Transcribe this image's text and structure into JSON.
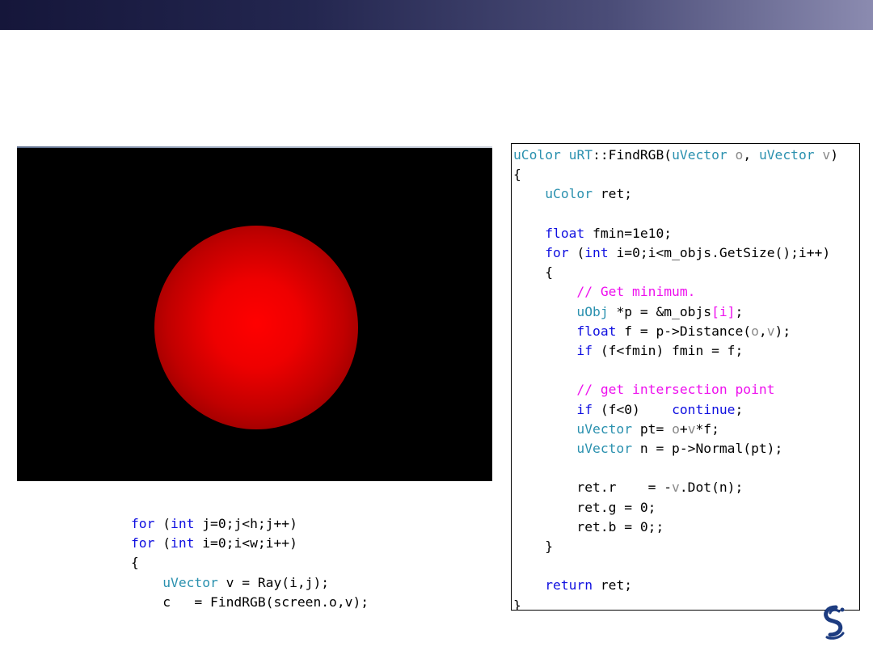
{
  "function_code": {
    "l1a": "uColor",
    "l1b": " ",
    "l1c": "uRT",
    "l1d": "::FindRGB(",
    "l1e": "uVector",
    "l1f": " ",
    "l1g": "o",
    "l1h": ", ",
    "l1i": "uVector",
    "l1j": " ",
    "l1k": "v",
    "l1l": ")",
    "l2": "{",
    "l3a": "    ",
    "l3b": "uColor",
    "l3c": " ret;",
    "l4": "",
    "l5a": "    ",
    "l5b": "float",
    "l5c": " fmin=1e10;",
    "l6a": "    ",
    "l6b": "for",
    "l6c": " (",
    "l6d": "int",
    "l6e": " i=0;i<m_objs.GetSize();i++)",
    "l7": "    {",
    "l8a": "        ",
    "l8b": "// Get minimum.",
    "l9a": "        ",
    "l9b": "uObj",
    "l9c": " *p = &m_objs",
    "l9d": "[i]",
    "l9e": ";",
    "l10a": "        ",
    "l10b": "float",
    "l10c": " f = p->Distance(",
    "l10d": "o",
    "l10e": ",",
    "l10f": "v",
    "l10g": ");",
    "l11a": "        ",
    "l11b": "if",
    "l11c": " (f<fmin) fmin = f;",
    "l12": "",
    "l13a": "        ",
    "l13b": "// get intersection point",
    "l14a": "        ",
    "l14b": "if",
    "l14c": " (f<0)    ",
    "l14d": "continue",
    "l14e": ";",
    "l15a": "        ",
    "l15b": "uVector",
    "l15c": " pt= ",
    "l15d": "o",
    "l15e": "+",
    "l15f": "v",
    "l15g": "*f;",
    "l16a": "        ",
    "l16b": "uVector",
    "l16c": " n = p->Normal(pt);",
    "l17": "",
    "l18a": "        ret.r    = -",
    "l18b": "v",
    "l18c": ".Dot(n);",
    "l19": "        ret.g = 0;",
    "l20": "        ret.b = 0;;",
    "l21": "    }",
    "l22": "",
    "l23a": "    ",
    "l23b": "return",
    "l23c": " ret;",
    "l24": "}"
  },
  "loop_code": {
    "l1a": "for",
    "l1b": " (",
    "l1c": "int",
    "l1d": " j=0;j<h;j++)",
    "l2a": "for",
    "l2b": " (",
    "l2c": "int",
    "l2d": " i=0;i<w;i++)",
    "l3": "{",
    "l4a": "    ",
    "l4b": "uVector",
    "l4c": " v = Ray(i,j);",
    "l5": "    c   = FindRGB(screen.o,v);"
  },
  "colors": {
    "keyword": "#1010e0",
    "type": "#2b91af",
    "comment": "#ee10ee",
    "param": "#8a8a8a",
    "sphere": "#ff0000",
    "title_bar": "#23264f"
  }
}
